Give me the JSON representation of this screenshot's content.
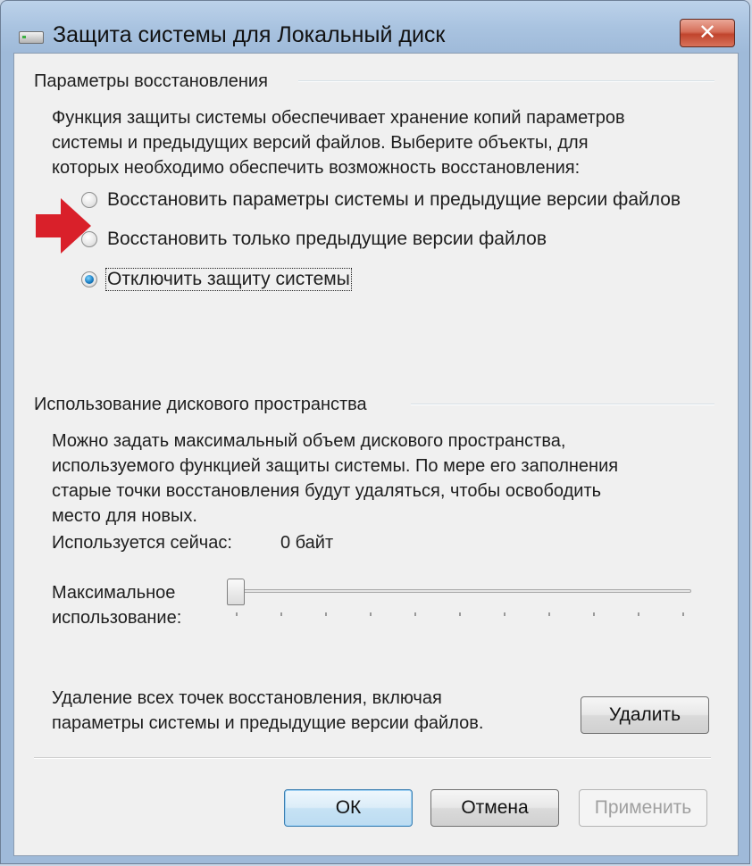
{
  "window": {
    "title": "Защита системы для Локальный диск",
    "icon": "drive-icon",
    "close_symbol": "✕"
  },
  "restore": {
    "group_title": "Параметры восстановления",
    "description_lines": [
      "Функция защиты системы обеспечивает хранение копий параметров",
      "системы и предыдущих версий файлов. Выберите объекты, для",
      "которых необходимо обеспечить возможность восстановления:"
    ],
    "options": [
      {
        "label": "Восстановить параметры системы и предыдущие версии файлов",
        "checked": false
      },
      {
        "label": "Восстановить только предыдущие версии файлов",
        "checked": false
      },
      {
        "label": "Отключить защиту системы",
        "checked": true
      }
    ],
    "arrow_color": "#d9202a"
  },
  "disk": {
    "group_title": "Использование дискового пространства",
    "description_lines": [
      "Можно задать максимальный объем дискового пространства,",
      "используемого функцией защиты системы. По мере его заполнения",
      "старые точки восстановления будут удаляться, чтобы освободить",
      "место для новых."
    ],
    "current_label": "Используется сейчас:",
    "current_value": "0 байт",
    "max_label_lines": [
      "Максимальное",
      "использование:"
    ],
    "slider_value_percent": 0
  },
  "delete": {
    "description_lines": [
      "Удаление всех точек восстановления, включая",
      "параметры системы и предыдущие версии файлов."
    ],
    "button_label": "Удалить"
  },
  "footer": {
    "ok_label": "ОК",
    "cancel_label": "Отмена",
    "apply_label": "Применить"
  }
}
